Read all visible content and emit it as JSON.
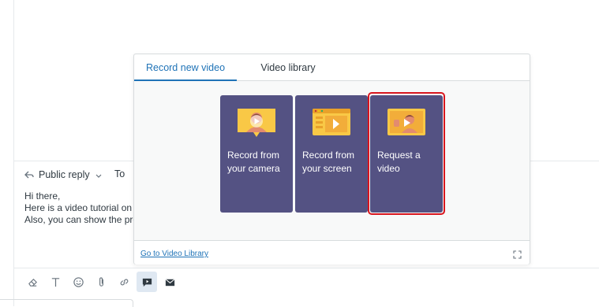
{
  "reply": {
    "mode_label": "Public reply",
    "to_label": "To",
    "body_lines": [
      "Hi there,",
      "Here is a video tutorial on c",
      "Also, you can show the pro"
    ]
  },
  "popup": {
    "tabs": [
      {
        "label": "Record new video",
        "active": true
      },
      {
        "label": "Video library",
        "active": false
      }
    ],
    "cards": [
      {
        "label": "Record from your camera",
        "icon": "camera-video-illustration-icon"
      },
      {
        "label": "Record from your screen",
        "icon": "screen-video-illustration-icon"
      },
      {
        "label": "Request a video",
        "icon": "request-video-illustration-icon",
        "highlighted": true
      }
    ],
    "footer_link": "Go to Video Library",
    "expand_icon": "expand-icon"
  },
  "toolbar": {
    "buttons": [
      {
        "icon": "eraser-icon"
      },
      {
        "icon": "text-format-icon"
      },
      {
        "icon": "emoji-icon"
      },
      {
        "icon": "attachment-icon"
      },
      {
        "icon": "link-icon"
      },
      {
        "icon": "video-message-icon",
        "active": true
      },
      {
        "icon": "email-icon"
      }
    ]
  },
  "colors": {
    "accent": "#1f73b7",
    "card_bg": "#545283",
    "highlight": "#d8151e",
    "illustration": "#f9c846"
  }
}
